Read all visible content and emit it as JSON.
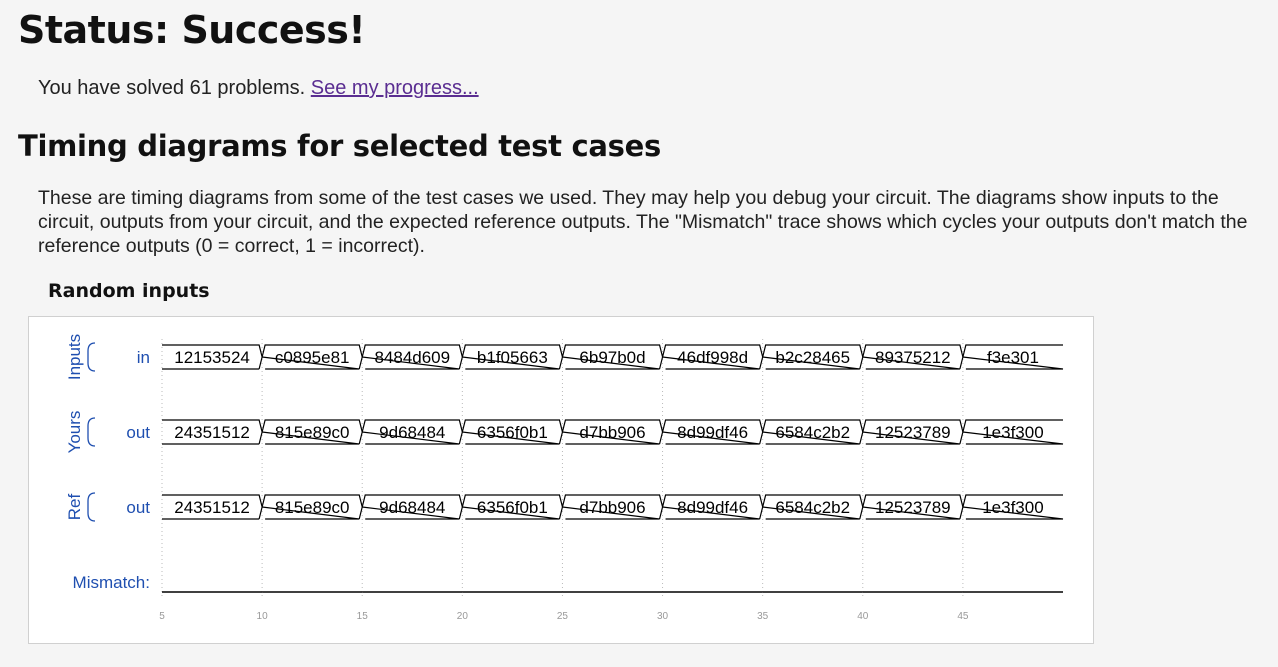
{
  "status_title": "Status: Success!",
  "solved": {
    "prefix": "You have solved 61 problems.",
    "link": "See my progress..."
  },
  "timing_heading": "Timing diagrams for selected test cases",
  "description": "These are timing diagrams from some of the test cases we used. They may help you debug your circuit. The diagrams show inputs to the circuit, outputs from your circuit, and the expected reference outputs. The \"Mismatch\" trace shows which cycles your outputs don't match the reference outputs (0 = correct, 1 = incorrect).",
  "test_case_title": "Random inputs",
  "waveform": {
    "groups": [
      {
        "name": "Inputs",
        "signal": "in",
        "values": [
          "12153524",
          "c0895e81",
          "8484d609",
          "b1f05663",
          "6b97b0d",
          "46df998d",
          "b2c28465",
          "89375212",
          "f3e301"
        ]
      },
      {
        "name": "Yours",
        "signal": "out",
        "values": [
          "24351512",
          "815e89c0",
          "9d68484",
          "6356f0b1",
          "d7bb906",
          "8d99df46",
          "6584c2b2",
          "12523789",
          "1e3f300"
        ]
      },
      {
        "name": "Ref",
        "signal": "out",
        "values": [
          "24351512",
          "815e89c0",
          "9d68484",
          "6356f0b1",
          "d7bb906",
          "8d99df46",
          "6584c2b2",
          "12523789",
          "1e3f300"
        ]
      }
    ],
    "mismatch_label": "Mismatch:",
    "mismatch_values": [
      0,
      0,
      0,
      0,
      0,
      0,
      0,
      0,
      0
    ],
    "time_ticks": [
      "5",
      "10",
      "15",
      "20",
      "25",
      "30",
      "35",
      "40",
      "45"
    ],
    "colors": {
      "label": "#1f4fb0",
      "trace": "#000000",
      "grid": "#bbbbbb",
      "tick": "#999999"
    }
  }
}
